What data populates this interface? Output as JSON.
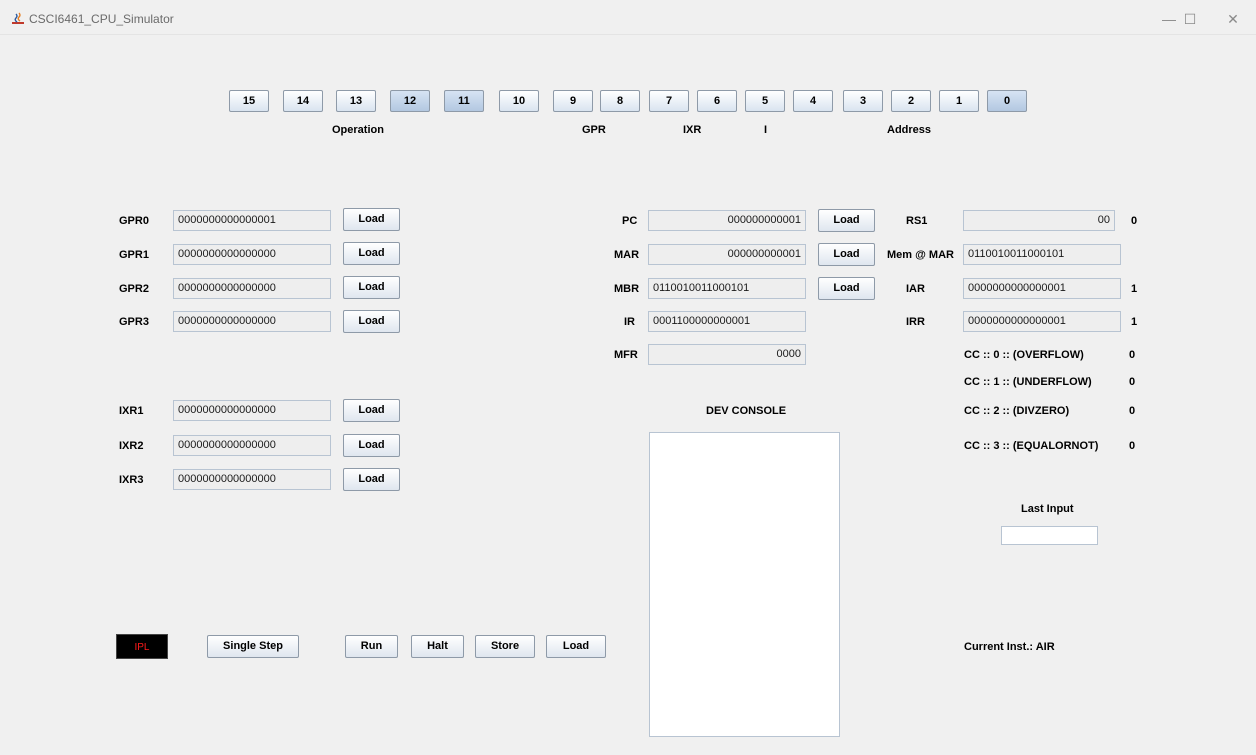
{
  "window": {
    "title": "CSCI6461_CPU_Simulator",
    "icon": "java-icon",
    "controls": {
      "minimize": "—",
      "maximize": "☐",
      "close": "✕"
    }
  },
  "bits": [
    {
      "label": "15",
      "selected": false
    },
    {
      "label": "14",
      "selected": false
    },
    {
      "label": "13",
      "selected": false
    },
    {
      "label": "12",
      "selected": true
    },
    {
      "label": "11",
      "selected": true
    },
    {
      "label": "10",
      "selected": false
    },
    {
      "label": "9",
      "selected": false
    },
    {
      "label": "8",
      "selected": false
    },
    {
      "label": "7",
      "selected": false
    },
    {
      "label": "6",
      "selected": false
    },
    {
      "label": "5",
      "selected": false
    },
    {
      "label": "4",
      "selected": false
    },
    {
      "label": "3",
      "selected": false
    },
    {
      "label": "2",
      "selected": false
    },
    {
      "label": "1",
      "selected": false
    },
    {
      "label": "0",
      "selected": true
    }
  ],
  "bit_groups": {
    "operation": "Operation",
    "gpr": "GPR",
    "ixr": "IXR",
    "i": "I",
    "address": "Address"
  },
  "load_label": "Load",
  "gprs": [
    {
      "label": "GPR0",
      "value": "0000000000000001"
    },
    {
      "label": "GPR1",
      "value": "0000000000000000"
    },
    {
      "label": "GPR2",
      "value": "0000000000000000"
    },
    {
      "label": "GPR3",
      "value": "0000000000000000"
    }
  ],
  "ixrs": [
    {
      "label": "IXR1",
      "value": "0000000000000000"
    },
    {
      "label": "IXR2",
      "value": "0000000000000000"
    },
    {
      "label": "IXR3",
      "value": "0000000000000000"
    }
  ],
  "regs": {
    "pc": {
      "label": "PC",
      "value": "000000000001"
    },
    "mar": {
      "label": "MAR",
      "value": "000000000001"
    },
    "mbr": {
      "label": "MBR",
      "value": "0110010011000101"
    },
    "ir": {
      "label": "IR",
      "value": "0001100000000001"
    },
    "mfr": {
      "label": "MFR",
      "value": "0000"
    }
  },
  "right": {
    "rs1": {
      "label": "RS1",
      "value": "00",
      "extra": "0"
    },
    "mem_at_mar": {
      "label": "Mem @ MAR",
      "value": "0110010011000101"
    },
    "iar": {
      "label": "IAR",
      "value": "0000000000000001",
      "extra": "1"
    },
    "irr": {
      "label": "IRR",
      "value": "0000000000000001",
      "extra": "1"
    },
    "cc": [
      {
        "label": "CC :: 0 :: (OVERFLOW)",
        "value": "0"
      },
      {
        "label": "CC :: 1 :: (UNDERFLOW)",
        "value": "0"
      },
      {
        "label": "CC :: 2 :: (DIVZERO)",
        "value": "0"
      },
      {
        "label": "CC :: 3 :: (EQUALORNOT)",
        "value": "0"
      }
    ],
    "last_input_label": "Last Input",
    "last_input_value": "",
    "current_inst": "Current Inst.: AIR"
  },
  "console": {
    "title": "DEV CONSOLE",
    "text": ""
  },
  "controls": {
    "ipl": "IPL",
    "single_step": "Single Step",
    "run": "Run",
    "halt": "Halt",
    "store": "Store",
    "load": "Load"
  },
  "colors": {
    "ipl_text": "#ff1a1a",
    "selected_bit": "#b3c8e1",
    "background": "#f0f0f0"
  }
}
